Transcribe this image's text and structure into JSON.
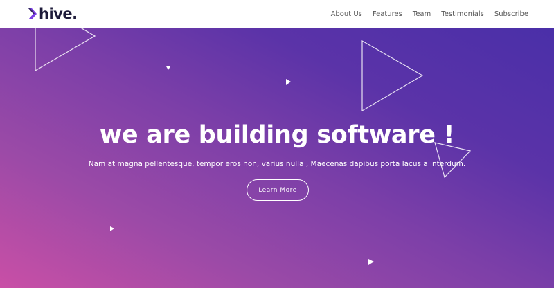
{
  "brand": {
    "name": "hive",
    "logo_icon": "chevron-logo-icon",
    "accent": "#7b3fe4"
  },
  "nav": {
    "links": [
      "About Us",
      "Features",
      "Team",
      "Testimonials",
      "Subscribe"
    ]
  },
  "hero": {
    "title": "we are building software !",
    "subtitle": "Nam at magna pellentesque, tempor eros non, varius nulla , Maecenas dapibus porta lacus a interdum.",
    "cta_label": "Learn More",
    "gradient_colors": [
      "#c94fa6",
      "#7c3fa8",
      "#4a2fa8"
    ]
  }
}
